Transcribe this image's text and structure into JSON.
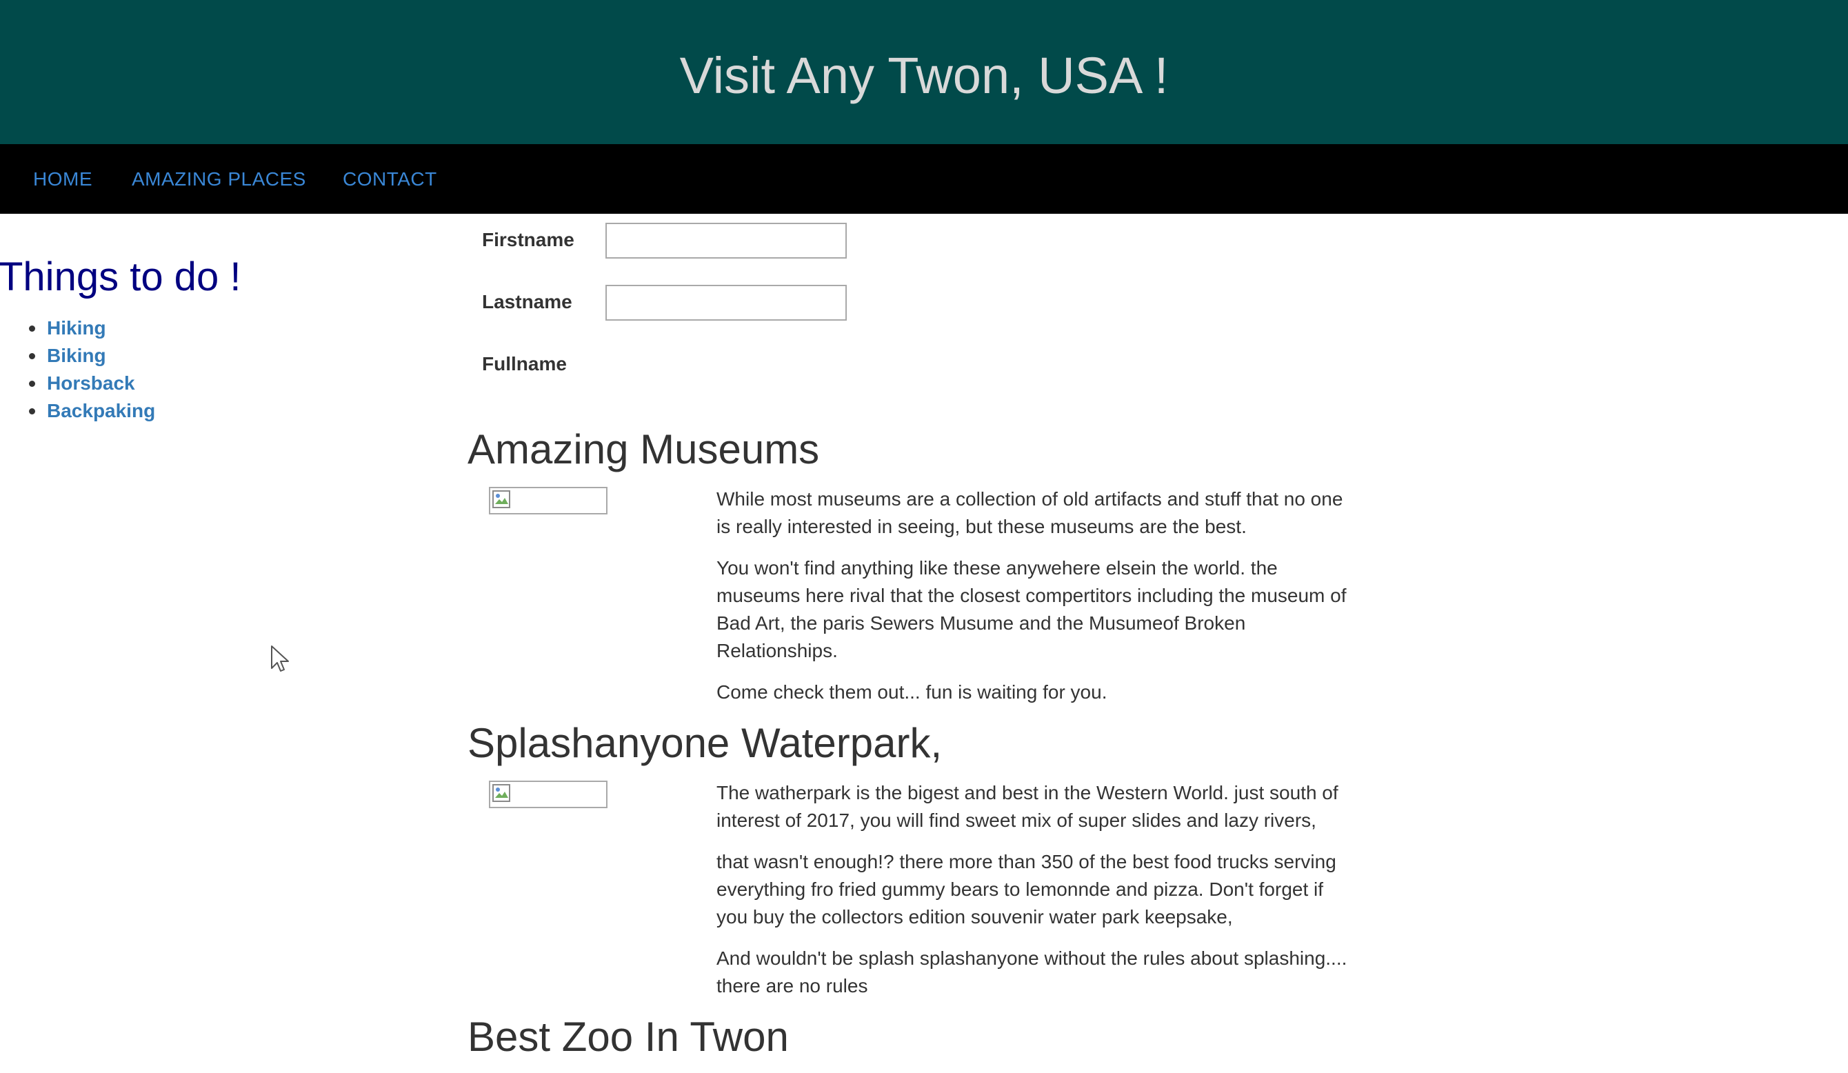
{
  "header": {
    "title": "Visit Any Twon, USA !",
    "background_color": "#014a4a"
  },
  "nav": {
    "items": [
      {
        "label": "HOME"
      },
      {
        "label": "AMAZING PLACES"
      },
      {
        "label": "CONTACT"
      }
    ],
    "link_color": "#3a87d6"
  },
  "sidebar": {
    "title": "Things to do !",
    "items": [
      {
        "label": "Hiking"
      },
      {
        "label": "Biking"
      },
      {
        "label": "Horsback"
      },
      {
        "label": "Backpaking"
      }
    ]
  },
  "form": {
    "firstname_label": "Firstname",
    "firstname_value": "",
    "lastname_label": "Lastname",
    "lastname_value": "",
    "fullname_label": "Fullname"
  },
  "sections": [
    {
      "heading": "Amazing Museums",
      "paragraphs": [
        "While most museums are a collection of old artifacts and stuff that no one is really interested in seeing, but these museums are the best.",
        "You won't find anything like these anywehere elsein the world. the museums here rival that the closest compertitors including the museum of Bad Art, the paris Sewers Musume and the Musumeof Broken Relationships.",
        "Come check them out... fun is waiting for you."
      ]
    },
    {
      "heading": "Splashanyone Waterpark,",
      "paragraphs": [
        "The watherpark is the bigest and best in the Western World. just south of interest of 2017, you will find sweet mix of super slides and lazy rivers,",
        "that wasn't enough!? there more than 350 of the best food trucks serving everything fro fried gummy bears to lemonnde and pizza. Don't forget if you buy the collectors edition souvenir water park keepsake,",
        "And wouldn't be splash splashanyone without the rules about splashing.... there are no rules"
      ]
    },
    {
      "heading": "Best Zoo In Twon"
    }
  ]
}
